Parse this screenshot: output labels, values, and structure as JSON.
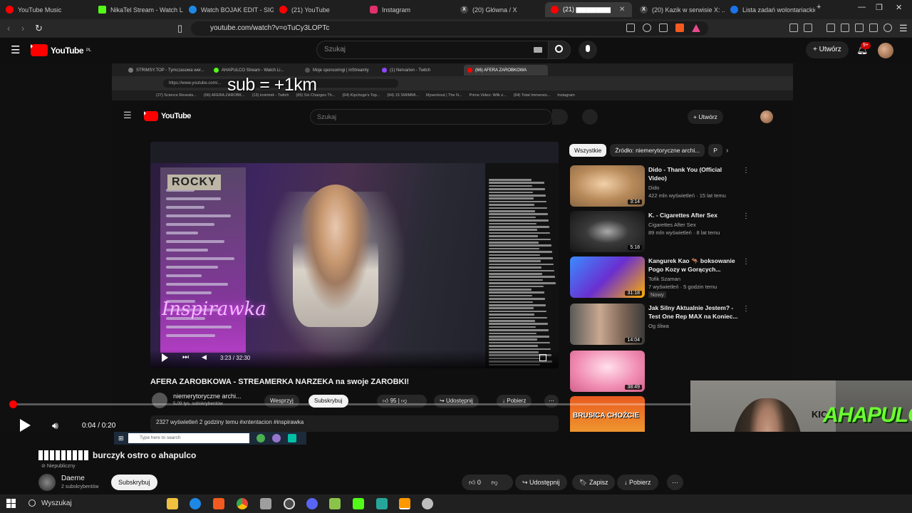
{
  "browser": {
    "tabs": [
      {
        "label": "YouTube Music",
        "color": "#ff0000"
      },
      {
        "label": "NikaTel Stream - Watch Li...",
        "color": "#53fc18"
      },
      {
        "label": "Watch BOJAK EDIT - SIGMA...",
        "color": "#1e88e5"
      },
      {
        "label": "(21) YouTube",
        "color": "#ff0000"
      },
      {
        "label": "Instagram",
        "color": "#e1306c"
      },
      {
        "label": "(20) Główna / X",
        "color": "#444444"
      },
      {
        "label": "(21) ▆▆▆▆▆▆▆",
        "color": "#ff0000"
      },
      {
        "label": "(20) Kazik w serwisie X: ...",
        "color": "#444444"
      },
      {
        "label": "Lista zadań wolontariackic...",
        "color": "#1a73e8"
      }
    ],
    "url": "youtube.com/watch?v=oTuCy3LOPTc"
  },
  "youtube": {
    "logo": "YouTube",
    "region": "PL",
    "search_placeholder": "Szukaj",
    "create_label": "Utwórz",
    "notif_badge": "9+"
  },
  "inner": {
    "tabs": [
      "STRIMSY.TOP - Tymczasowa wer...",
      "AHAPULCO Stream - Watch Li...",
      "Moje sponsoringi | inStreamly",
      "(1) Nervarien - Twitch",
      "(66) AFERA ZAROBKOWA"
    ],
    "url": "https://www.youtube.com/...",
    "overlay": "sub = +1km",
    "bookmarks": [
      "(27) Science Reveals...",
      "(66) AFERA ZAROBK...",
      "(13) instrimik - Twitch",
      "(65) Six Changes Th...",
      "(64) Kipchoge's Top...",
      "(64) 15 SWIMMI...",
      "Myworkout | The N...",
      "Prime Video: Wilk z...",
      "(64) Total Immersio...",
      "Instagram"
    ],
    "search_placeholder": "Szukaj",
    "create_label": "Utwórz",
    "player_time": "3:23 / 32:30",
    "stream_sign": "Inspirawka",
    "rocky_sign": "ROCKY",
    "title": "AFERA ZAROBKOWA - STREAMERKA NARZEKA na swoje ZAROBKI!",
    "channel": "niemerytoryczne archi...",
    "subs": "5,09 tys. subskrybentów",
    "support_label": "Wesprzyj",
    "subscribe_label": "Subskrybuj",
    "likes": "95",
    "share_label": "Udostępnij",
    "download_label": "Pobierz",
    "meta": "2327 wyświetleń  2 godziny temu  #xntentacion #inspirawka",
    "chips": [
      "Wszystkie",
      "Źródło: niemerytoryczne archi...",
      "P"
    ],
    "recs": [
      {
        "title": "Dido - Thank You (Official Video)",
        "channel": "Dido",
        "stats": "422 mln wyświetleń · 15 lat temu",
        "dur": "3:14"
      },
      {
        "title": "K. - Cigarettes After Sex",
        "channel": "Cigarettes After Sex",
        "stats": "89 mln wyświetleń · 8 lat temu",
        "dur": "5:18"
      },
      {
        "title": "Kangurek Kao 🦘 boksowanie Pogo Kozy w Gorących...",
        "channel": "Tofik Szaman",
        "stats": "7 wyświetleń · 5 godzin temu",
        "badge": "Nowy",
        "dur": "31:18"
      },
      {
        "title": "Jak Silny Aktualnie Jestem? - Test One Rep MAX na Koniec...",
        "channel": "Og śliwa",
        "stats": "",
        "dur": "14:04"
      },
      {
        "title": "",
        "channel": "",
        "stats": "",
        "dur": "38:49"
      },
      {
        "title": "",
        "channel": "",
        "stats": "",
        "dur": ""
      }
    ],
    "rec5_text": "BRUSICA CHOŹCIE"
  },
  "webcam": {
    "logo": "AHAPULCO",
    "kick": "KICK"
  },
  "player": {
    "time": "0:04 / 0:20",
    "progress_fraction": 0.003
  },
  "video": {
    "title": "burczyk ostro o ahapulco",
    "visibility": "Niepubliczny",
    "channel": "Daerne",
    "subs": "2 subskrybentów",
    "subscribe_label": "Subskrybuj",
    "likes": "0",
    "share_label": "Udostępnij",
    "save_label": "Zapisz",
    "download_label": "Pobierz"
  },
  "inner_taskbar": {
    "search": "Type here to search"
  },
  "taskbar": {
    "search": "Wyszukaj"
  }
}
